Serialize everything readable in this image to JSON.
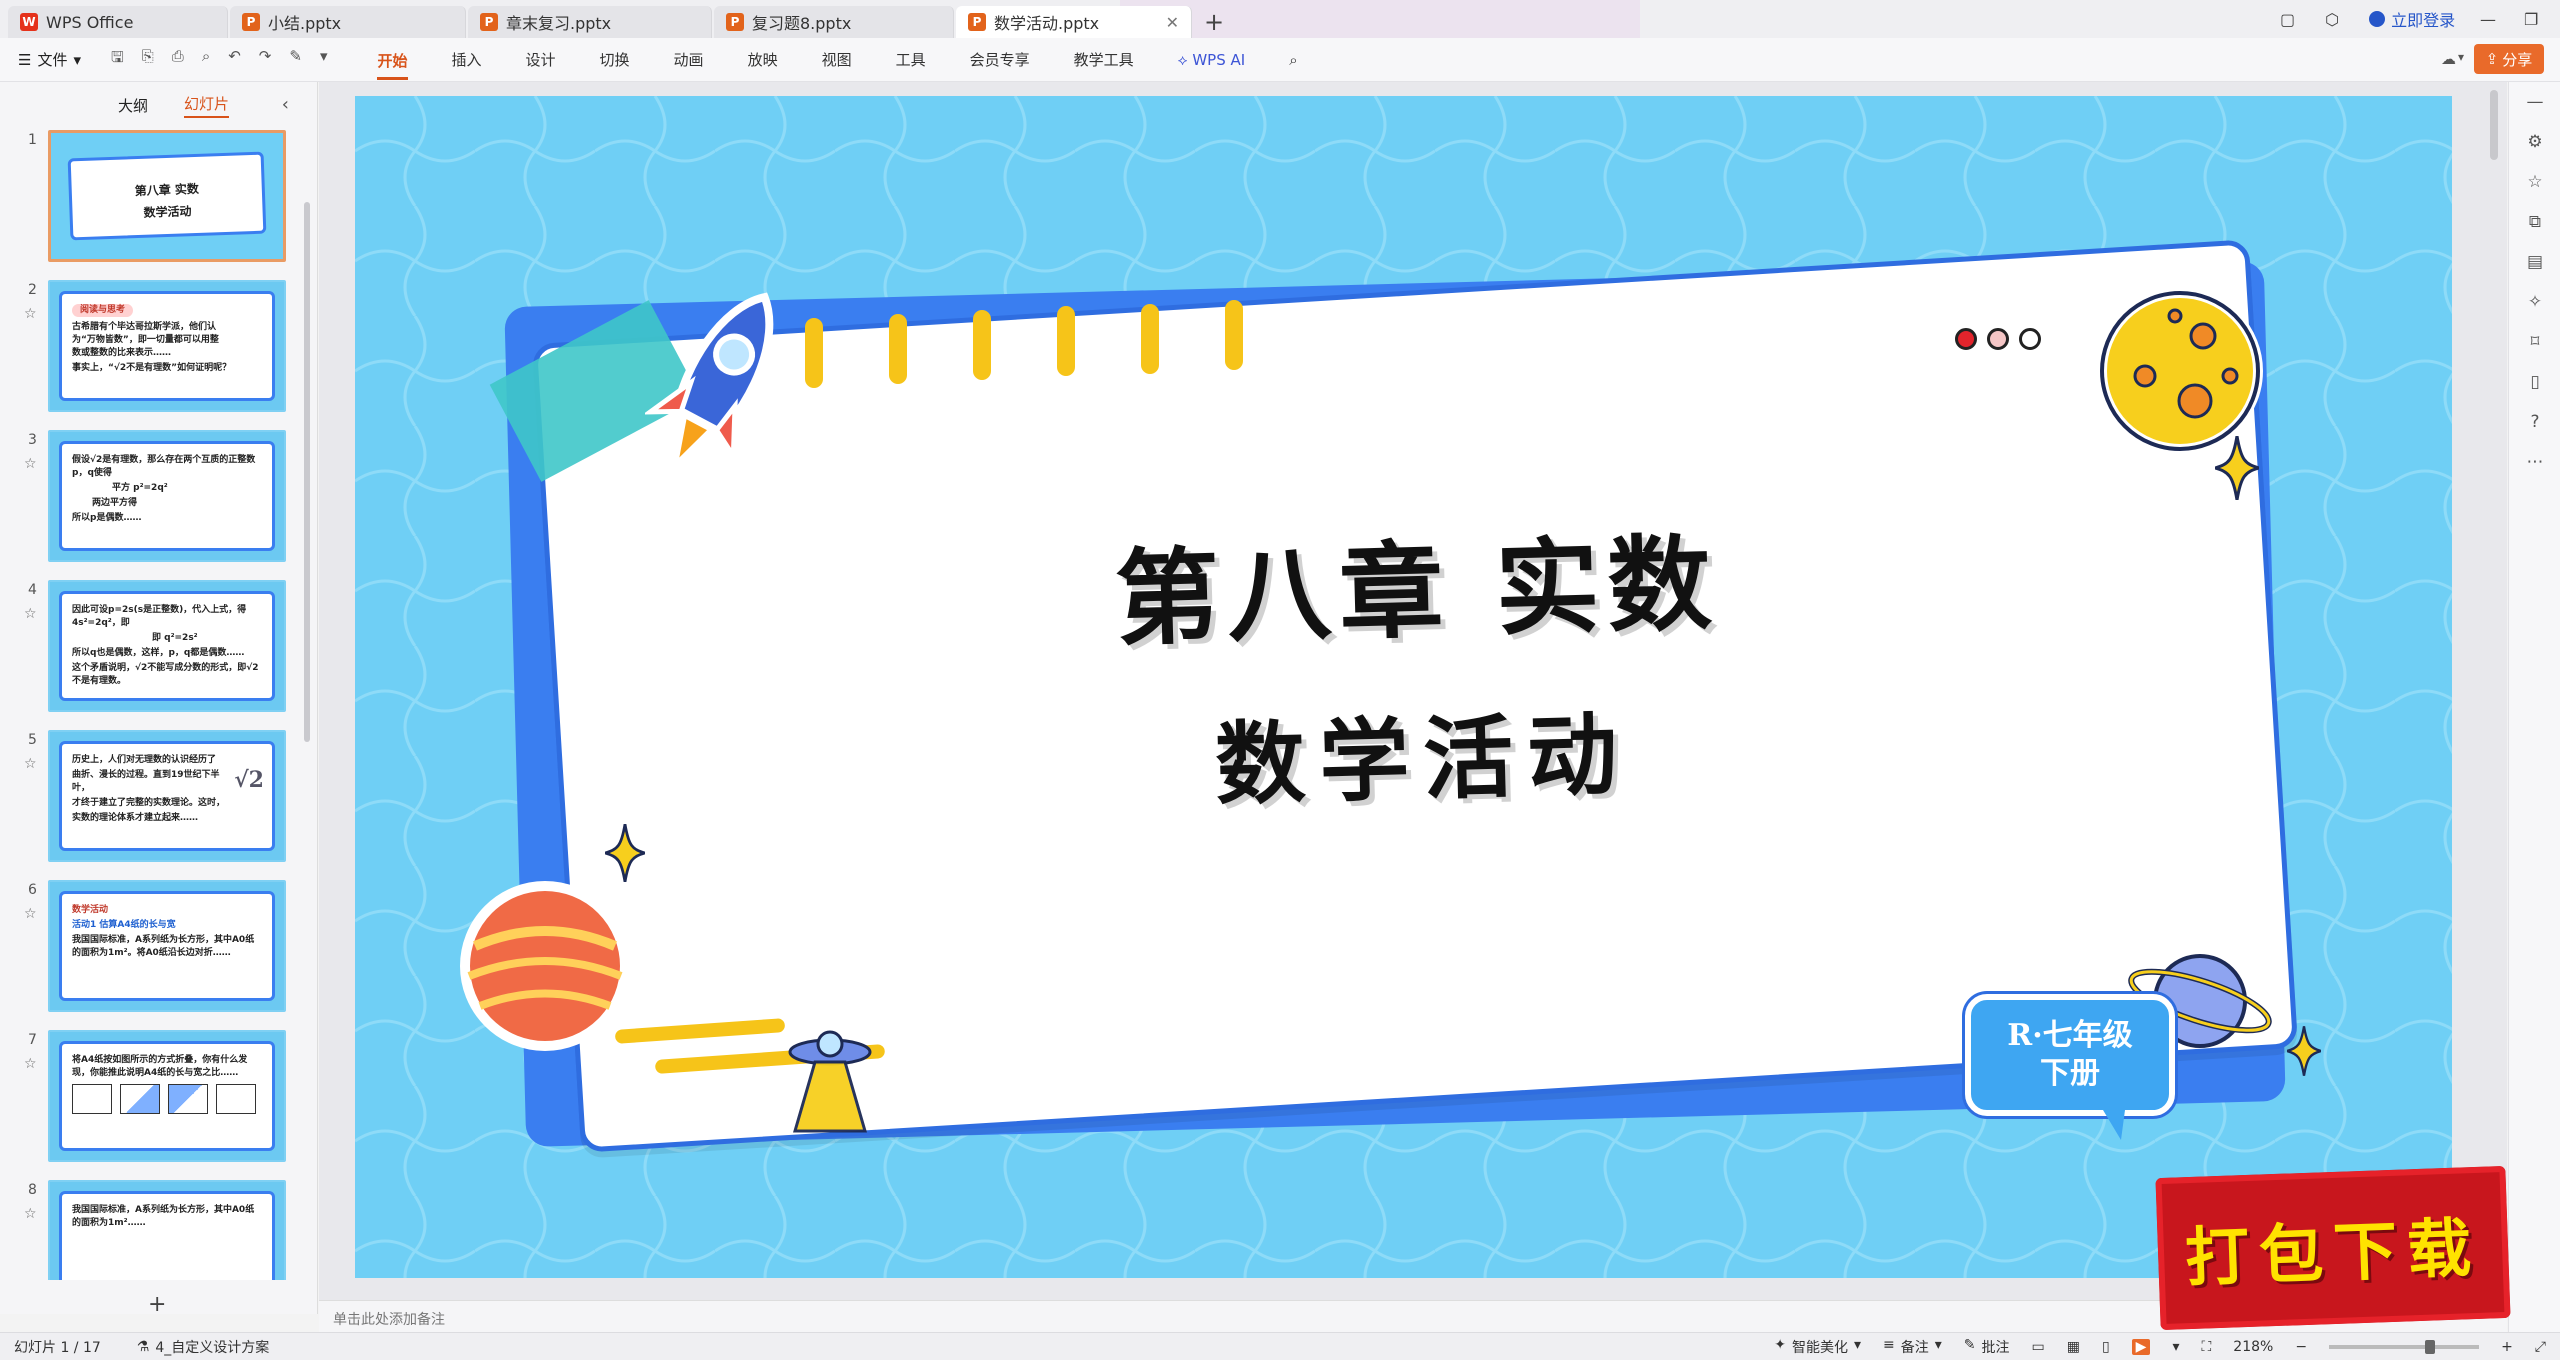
{
  "tabs": [
    {
      "label": "WPS Office",
      "kind": "wps"
    },
    {
      "label": "小结.pptx",
      "kind": "ppt"
    },
    {
      "label": "章末复习.pptx",
      "kind": "ppt"
    },
    {
      "label": "复习题8.pptx",
      "kind": "ppt"
    },
    {
      "label": "数学活动.pptx",
      "kind": "ppt",
      "active": true
    }
  ],
  "titlebar": {
    "login": "立即登录"
  },
  "ribbon": {
    "file": "文件",
    "items": [
      "开始",
      "插入",
      "设计",
      "切换",
      "动画",
      "放映",
      "视图",
      "工具",
      "会员专享",
      "教学工具",
      "WPS AI"
    ],
    "active": "开始",
    "share": "分享"
  },
  "panel": {
    "tab_outline": "大纲",
    "tab_slides": "幻灯片"
  },
  "thumbs": [
    {
      "num": "1",
      "lines": [
        "第八章 实数",
        "数学活动"
      ]
    },
    {
      "num": "2",
      "lines": [
        "阅读与思考",
        "古希腊有个毕达哥拉斯学派，他们认为“万物皆数”，即一切量都可以用整数或整数的比来表示……",
        "事实上，“√2不是有理数”如何证明呢？"
      ]
    },
    {
      "num": "3",
      "lines": [
        "假设√2是有理数，那么存在两个互质的正整数p，q使得",
        "平方   p²=2q²",
        "两边平方得",
        "所以p是偶数……"
      ]
    },
    {
      "num": "4",
      "lines": [
        "因此可设p=2s(s是正整数)，代入上式，得4s²=2q²，即",
        "即 q²=2s²",
        "所以q也是偶数，这样，p，q都是偶数……",
        "这个矛盾说明，√2不能写成分数的形式，即√2不是有理数。"
      ]
    },
    {
      "num": "5",
      "lines": [
        "历史上，人们对无理数的认识经历了",
        "曲折、漫长的过程。直到19世纪下半叶，",
        "才终于建立了完整的实数理论。这时，",
        "实数的理论体系才建立起来……"
      ]
    },
    {
      "num": "6",
      "lines": [
        "数学活动",
        "活动1  估算A4纸的长与宽",
        "我国国际标准，A系列纸为长方形，其中A0纸的面积为1m²。将A0纸沿长边对折……"
      ]
    },
    {
      "num": "7",
      "lines": [
        "将A4纸按如图所示的方式折叠，你有什么发现，你能推此说明A4纸的长与宽之比……"
      ]
    },
    {
      "num": "8",
      "lines": [
        "我国国际标准，A系列纸为长方形，其中A0纸的面积为1m²……"
      ]
    }
  ],
  "slide": {
    "title": "第八章 实数",
    "subtitle": "数学活动",
    "badge_line1": "R·七年级",
    "badge_line2": "下册"
  },
  "notes_placeholder": "单击此处添加备注",
  "status": {
    "slide_counter": "幻灯片 1 / 17",
    "theme": "4_自定义设计方案",
    "beautify": "智能美化",
    "notes": "备注",
    "comments": "批注",
    "zoom": "218%"
  },
  "download_badge": "打包下载",
  "colors": {
    "accent": "#d8531a",
    "slide_bg": "#6fcff5",
    "frame": "#3a7ef0"
  }
}
